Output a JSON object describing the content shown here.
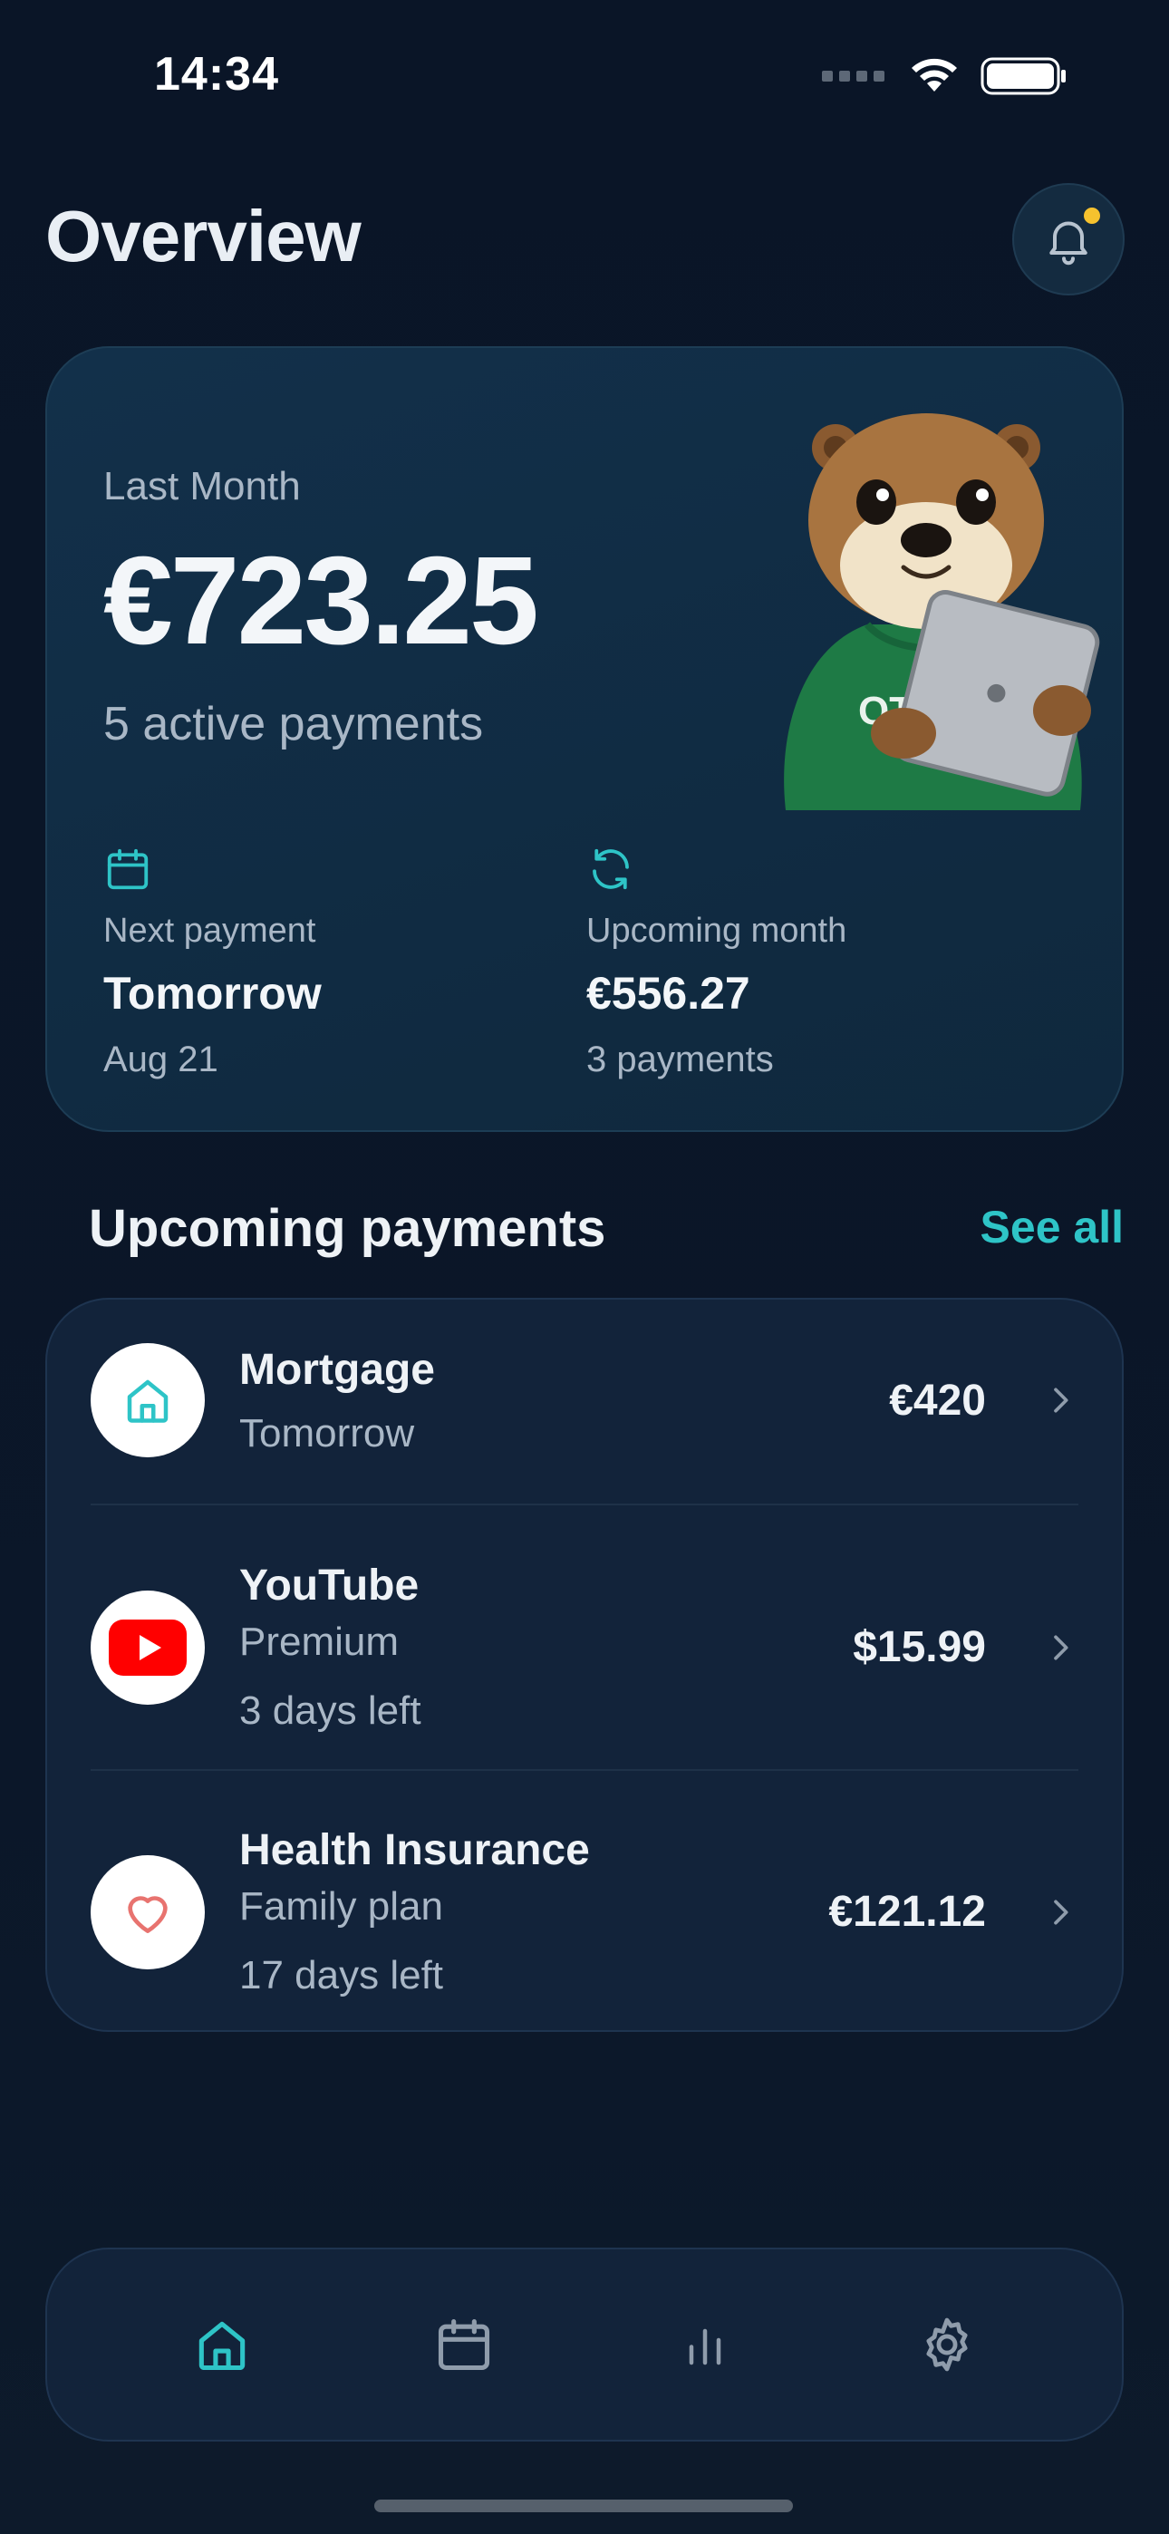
{
  "status_bar": {
    "time": "14:34"
  },
  "header": {
    "title": "Overview"
  },
  "summary": {
    "period_label": "Last Month",
    "total": "€723.25",
    "active_payments": "5 active payments",
    "next_payment": {
      "label": "Next payment",
      "value": "Tomorrow",
      "sub": "Aug 21"
    },
    "upcoming_month": {
      "label": "Upcoming month",
      "value": "€556.27",
      "sub": "3 payments"
    },
    "mascot_shirt_text": "OT"
  },
  "upcoming": {
    "title": "Upcoming payments",
    "see_all": "See all",
    "items": [
      {
        "name": "Mortgage",
        "lines": [
          "Tomorrow"
        ],
        "amount": "€420",
        "icon": "house-icon"
      },
      {
        "name": "YouTube",
        "lines": [
          "Premium",
          "3 days left"
        ],
        "amount": "$15.99",
        "icon": "youtube-icon"
      },
      {
        "name": "Health Insurance",
        "lines": [
          "Family plan",
          "17 days left"
        ],
        "amount": "€121.12",
        "icon": "heart-icon"
      }
    ]
  },
  "tab_bar": {
    "tabs": [
      {
        "icon": "home-icon",
        "active": true
      },
      {
        "icon": "calendar-icon",
        "active": false
      },
      {
        "icon": "bar-chart-icon",
        "active": false
      },
      {
        "icon": "gear-icon",
        "active": false
      }
    ]
  },
  "colors": {
    "accent": "#2ec4c7",
    "background": "#0b1628",
    "card": "#12233a",
    "notification_dot": "#f6c22e",
    "youtube_red": "#ff0000",
    "heart": "#e8736f"
  }
}
